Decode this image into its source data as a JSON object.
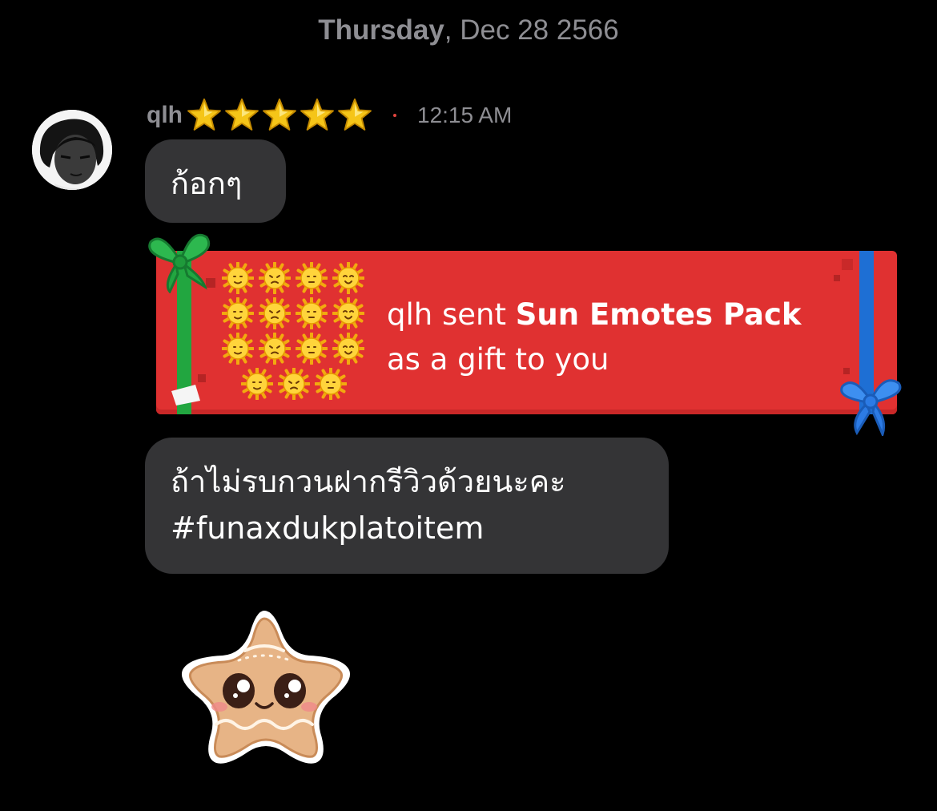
{
  "date_header": {
    "day": "Thursday",
    "rest": ", Dec 28 2566"
  },
  "message": {
    "username": "qlh",
    "badge_star_count": 5,
    "timestamp": "12:15 AM",
    "avatar_icon": "user-avatar-photo",
    "text_1": "ก้อกๆ",
    "gift": {
      "sender_prefix": "qlh sent ",
      "item_name": "Sun Emotes Pack",
      "suffix": "as a gift to you",
      "emote_icon": "sun-face-emote",
      "emote_count": 15
    },
    "text_2_line1": "ถ้าไม่รบกวนฝากรีวิวด้วยนะคะ",
    "text_2_line2": "#funaxdukplatoitem",
    "sticker_icon": "gingerbread-star-cookie-sticker"
  },
  "colors": {
    "background": "#000000",
    "bubble": "#343436",
    "meta_gray": "#8e8e93",
    "gift_red": "#e03131",
    "ribbon_green": "#22a640",
    "ribbon_blue": "#1e6fd4",
    "star_gold": "#f5c518"
  }
}
